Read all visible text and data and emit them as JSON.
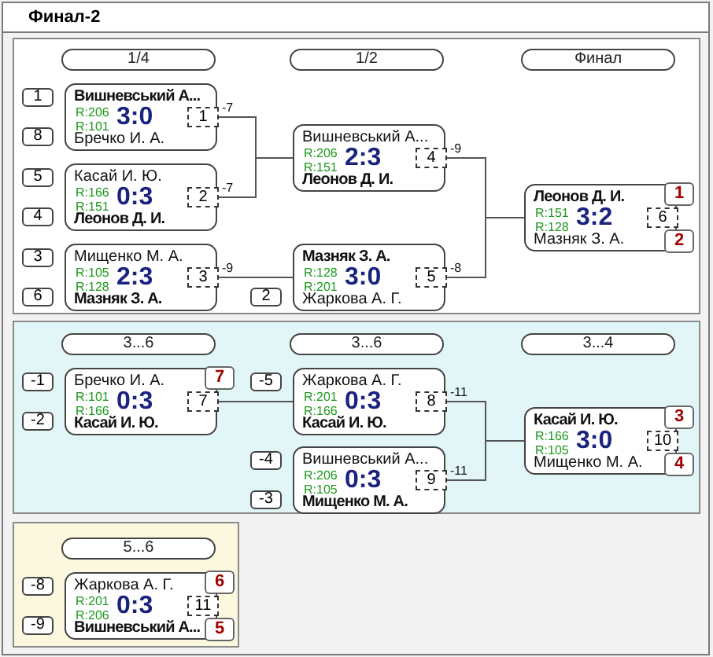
{
  "title": "Финал-2",
  "panels": [
    {
      "kind": "main",
      "rounds": [
        "1/4",
        "1/2",
        "Финал"
      ],
      "matches": [
        {
          "number": "1",
          "score": "3:0",
          "next": "-7",
          "players": [
            {
              "name": "Вишневський А...",
              "rating": "R:206",
              "winner": true,
              "seed": "1"
            },
            {
              "name": "Бречко И. А.",
              "rating": "R:101",
              "winner": false,
              "seed": "8"
            }
          ]
        },
        {
          "number": "2",
          "score": "0:3",
          "next": "-7",
          "players": [
            {
              "name": "Касай И. Ю.",
              "rating": "R:166",
              "winner": false,
              "seed": "5"
            },
            {
              "name": "Леонов Д. И.",
              "rating": "R:151",
              "winner": true,
              "seed": "4"
            }
          ]
        },
        {
          "number": "3",
          "score": "2:3",
          "next": "-9",
          "players": [
            {
              "name": "Мищенко М. А.",
              "rating": "R:105",
              "winner": false,
              "seed": "3"
            },
            {
              "name": "Мазняк З. А.",
              "rating": "R:128",
              "winner": true,
              "seed": "6"
            }
          ]
        },
        {
          "number": "4",
          "score": "2:3",
          "next": "-9",
          "players": [
            {
              "name": "Вишневський А...",
              "rating": "R:206",
              "winner": false
            },
            {
              "name": "Леонов Д. И.",
              "rating": "R:151",
              "winner": true
            }
          ]
        },
        {
          "number": "5",
          "score": "3:0",
          "next": "-8",
          "players": [
            {
              "name": "Мазняк З. А.",
              "rating": "R:128",
              "winner": true
            },
            {
              "name": "Жаркова А. Г.",
              "rating": "R:201",
              "winner": false,
              "seed": "2"
            }
          ]
        },
        {
          "number": "6",
          "score": "3:2",
          "players": [
            {
              "name": "Леонов Д. И.",
              "rating": "R:151",
              "winner": true,
              "place": "1"
            },
            {
              "name": "Мазняк З. А.",
              "rating": "R:128",
              "winner": false,
              "place": "2"
            }
          ]
        }
      ]
    },
    {
      "kind": "consolation",
      "rounds": [
        "3...6",
        "3...6",
        "3...4"
      ],
      "matches": [
        {
          "number": "7",
          "score": "0:3",
          "players": [
            {
              "name": "Бречко И. А.",
              "rating": "R:101",
              "winner": false,
              "seed": "-1",
              "place": "7"
            },
            {
              "name": "Касай И. Ю.",
              "rating": "R:166",
              "winner": true,
              "seed": "-2"
            }
          ]
        },
        {
          "number": "8",
          "score": "0:3",
          "next": "-11",
          "players": [
            {
              "name": "Жаркова А. Г.",
              "rating": "R:201",
              "winner": false,
              "seed": "-5"
            },
            {
              "name": "Касай И. Ю.",
              "rating": "R:166",
              "winner": true
            }
          ]
        },
        {
          "number": "9",
          "score": "0:3",
          "next": "-11",
          "players": [
            {
              "name": "Вишневський А...",
              "rating": "R:206",
              "winner": false,
              "seed": "-4"
            },
            {
              "name": "Мищенко М. А.",
              "rating": "R:105",
              "winner": true,
              "seed": "-3"
            }
          ]
        },
        {
          "number": "10",
          "score": "3:0",
          "players": [
            {
              "name": "Касай И. Ю.",
              "rating": "R:166",
              "winner": true,
              "place": "3"
            },
            {
              "name": "Мищенко М. А.",
              "rating": "R:105",
              "winner": false,
              "place": "4"
            }
          ]
        }
      ]
    },
    {
      "kind": "placing",
      "rounds": [
        "5...6"
      ],
      "matches": [
        {
          "number": "11",
          "score": "0:3",
          "players": [
            {
              "name": "Жаркова А. Г.",
              "rating": "R:201",
              "winner": false,
              "seed": "-8",
              "place": "6"
            },
            {
              "name": "Вишневський А...",
              "rating": "R:206",
              "winner": true,
              "seed": "-9",
              "place": "5"
            }
          ]
        }
      ]
    }
  ]
}
